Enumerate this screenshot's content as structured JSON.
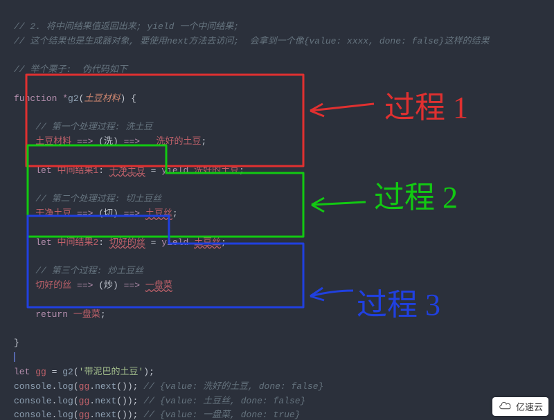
{
  "c1": "// 2. 将中间结果值返回出来; yield 一个中间结果;",
  "c2": "// 这个结果也是生成器对象, 要使用next方法去访问;  会拿到一个像{value: xxxx, done: false}这样的结果",
  "c3": "// 举个栗子:  伪代码如下",
  "fn_kw": "function",
  "star": "*",
  "fn_name": "g2",
  "p_open": "(",
  "fn_param": "土豆材料",
  "p_close": ")",
  "brace_open": " {",
  "sec1_c": "// 第一个处理过程: 洗土豆",
  "l1_a": "土豆材料",
  "arrow": " ==> ",
  "l1_op": "(洗)",
  "l1_r": "洗好的土豆",
  "semi": ";",
  "let_kw": "let",
  "m1_name": "中间结果1",
  "m1_val": "干净土豆",
  "eq": " = ",
  "colon": ": ",
  "yield_kw": "yield",
  "m1_y": "洗好的土豆",
  "sec2_c": "// 第二个处理过程: 切土豆丝",
  "l2_a": "干净土豆",
  "l2_op": "(切)",
  "l2_r": "土豆丝",
  "m2_name": "中间结果2",
  "m2_val": "切好的丝",
  "m2_y": "土豆丝",
  "sec3_c": "// 第三个过程: 炒土豆丝",
  "l3_a": "切好的丝",
  "l3_op": "(炒)",
  "l3_r": "一盘菜",
  "ret_kw": "return",
  "ret_v": "一盘菜",
  "brace_close": "}",
  "gg_let": "let",
  "gg": "gg",
  "gg_eq": " = ",
  "gg_call": "g2",
  "gg_arg": "'带泥巴的土豆'",
  "cons": "console",
  "log": "log",
  "next": "next",
  "cc1": "// {value: 洗好的土豆, done: false}",
  "cc2": "// {value: 土豆丝, done: false}",
  "cc3": "// {value: 一盘菜, done: true}",
  "hand1": "过程 1",
  "hand2": "过程 2",
  "hand3": "过程 3",
  "watermark": "亿速云"
}
